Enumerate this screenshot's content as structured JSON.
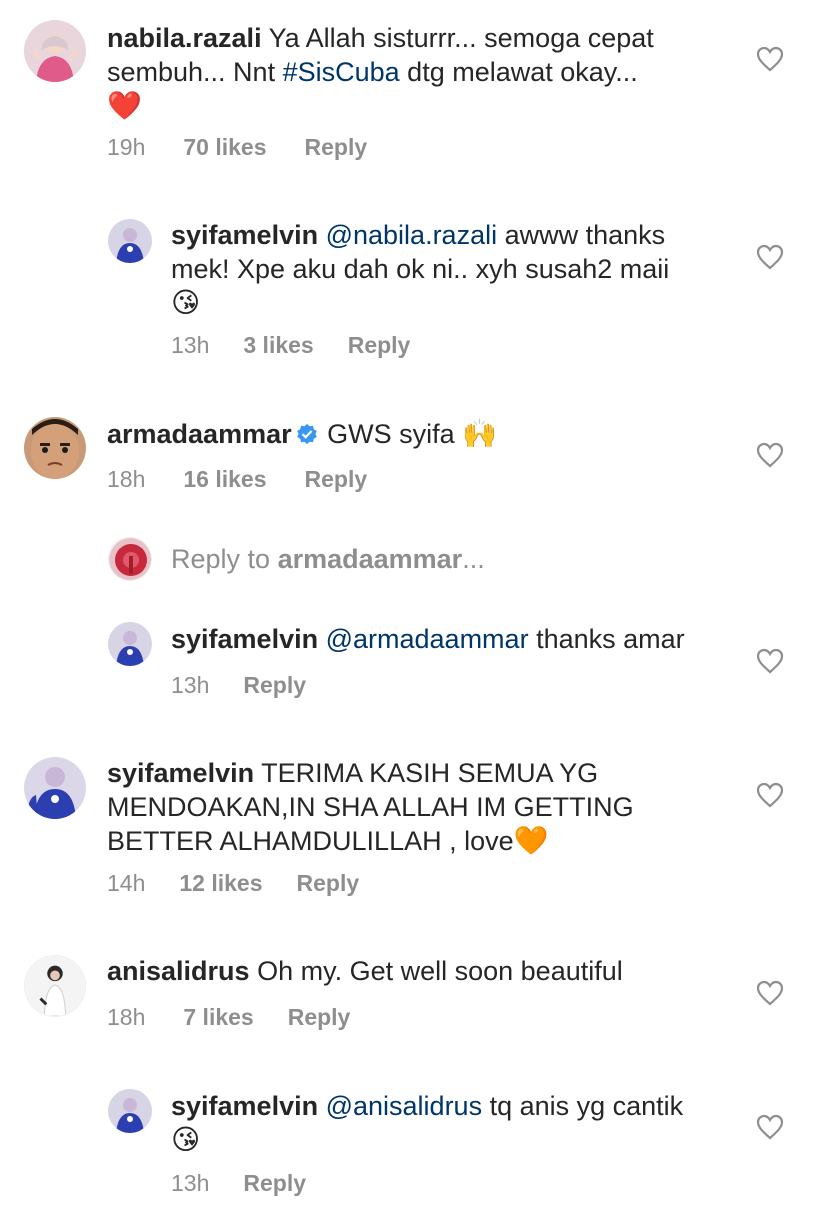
{
  "comments": [
    {
      "username": "nabila.razali",
      "text_before": " Ya Allah sisturrr... semoga cepat sembuh... Nnt ",
      "hashtag": "#SisCuba",
      "text_after": " dtg melawat okay...",
      "emoji": "❤️",
      "time": "19h",
      "likes": "70 likes",
      "reply": "Reply"
    },
    {
      "username": "syifamelvin",
      "mention": "@nabila.razali",
      "text": " awww thanks mek! Xpe aku dah ok ni.. xyh susah2 maii",
      "emoji": "😘",
      "time": "13h",
      "likes": "3 likes",
      "reply": "Reply"
    },
    {
      "username": "armadaammar",
      "text": " GWS syifa ",
      "emoji": "🙌",
      "time": "18h",
      "likes": "16 likes",
      "reply": "Reply"
    },
    {
      "reply_prompt": "Reply to ",
      "reply_target": "armadaammar",
      "reply_ellipsis": "..."
    },
    {
      "username": "syifamelvin",
      "mention": "@armadaammar",
      "text": " thanks amar",
      "time": "13h",
      "reply": "Reply"
    },
    {
      "username": "syifamelvin",
      "text": " TERIMA KASIH SEMUA YG MENDOAKAN,IN SHA ALLAH IM GETTING BETTER ALHAMDULILLAH , love",
      "emoji": "🧡",
      "time": "14h",
      "likes": "12 likes",
      "reply": "Reply"
    },
    {
      "username": "anisalidrus",
      "text": " Oh my. Get well soon beautiful",
      "time": "18h",
      "likes": "7 likes",
      "reply": "Reply"
    },
    {
      "username": "syifamelvin",
      "mention": "@anisalidrus",
      "text": " tq anis yg cantik",
      "emoji": "😘",
      "time": "13h",
      "reply": "Reply"
    }
  ],
  "colors": {
    "text": "#262626",
    "meta": "#8e8e8e",
    "link": "#003569",
    "verified": "#3897f0"
  },
  "icons": {
    "like": "heart-outline-icon",
    "verified": "verified-badge-icon"
  }
}
